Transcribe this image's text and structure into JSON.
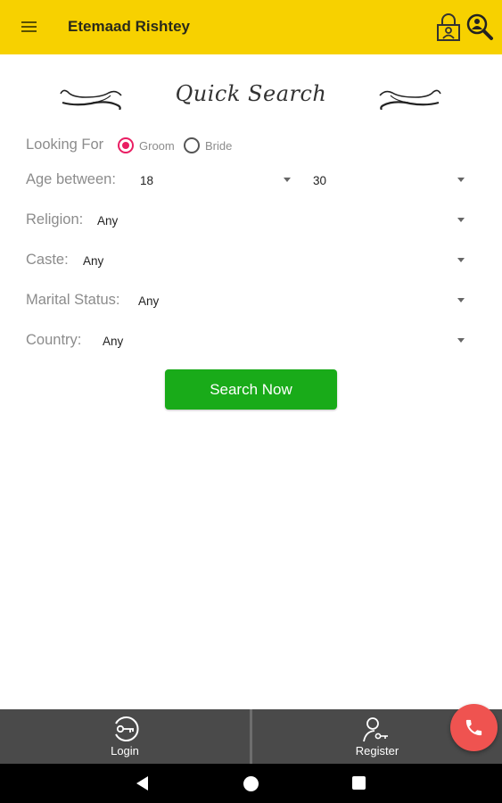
{
  "app": {
    "title": "Etemaad Rishtey",
    "menu_icon": "hamburger-menu-icon",
    "lock_icon": "user-lock-icon",
    "search_icon": "search-user-icon",
    "bar_color": "#f7d100"
  },
  "search_form": {
    "heading": "Quick Search",
    "looking_for": {
      "label": "Looking For",
      "options": [
        "Groom",
        "Bride"
      ],
      "selected": "Groom"
    },
    "age": {
      "label": "Age between:",
      "min": "18",
      "max": "30"
    },
    "religion": {
      "label": "Religion:",
      "value": "Any"
    },
    "caste": {
      "label": "Caste:",
      "value": "Any"
    },
    "marital_status": {
      "label": "Marital Status:",
      "value": "Any"
    },
    "country": {
      "label": "Country:",
      "value": "Any"
    },
    "submit_label": "Search Now",
    "submit_color": "#19ab19",
    "radio_accent": "#e91e63"
  },
  "bottom_nav": {
    "login_label": "Login",
    "register_label": "Register",
    "login_icon": "key-login-icon",
    "register_icon": "user-key-icon"
  },
  "fab": {
    "icon": "phone-icon",
    "color": "#ef5350"
  },
  "system_nav": {
    "back": "back-triangle-icon",
    "home": "home-circle-icon",
    "recents": "recents-square-icon"
  }
}
